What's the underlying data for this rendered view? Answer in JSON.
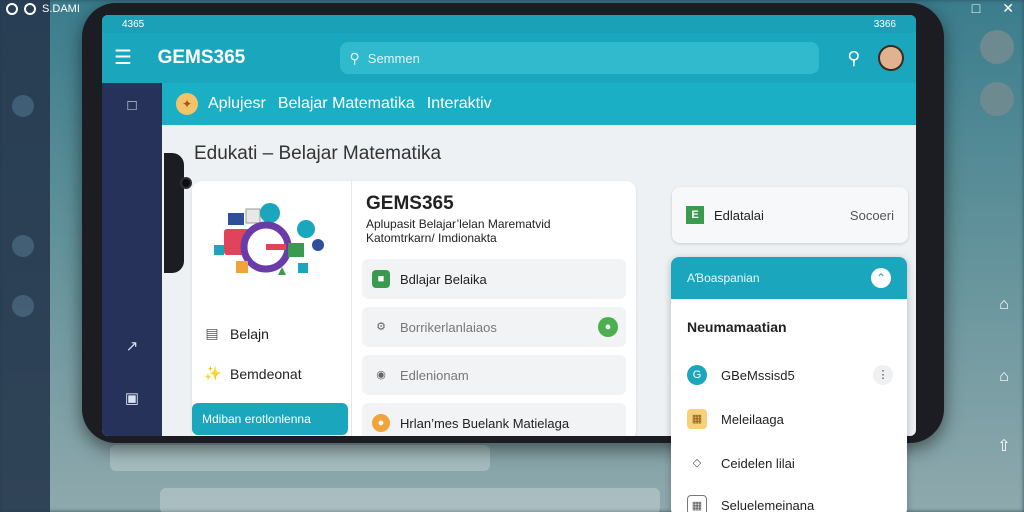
{
  "outer": {
    "status_text": "S.DAMI"
  },
  "phone_status": {
    "time": "4365",
    "battery": "3366"
  },
  "appbar": {
    "title": "GEMS365",
    "search_placeholder": "Semmen"
  },
  "subbar": {
    "items": [
      "Aplujesr",
      "Belajar Matematika",
      "Interaktiv"
    ]
  },
  "page": {
    "heading": "Edukati – Belajar Matematika"
  },
  "card": {
    "title": "GEMS365",
    "subtitle": "Aplupasit Belajar’lelan Marematvid Katomtrkarn/ Imdionakta",
    "left_items": [
      "Belajn",
      "Bemdeonat"
    ],
    "left_button": "Mdiban erotlonlenna",
    "rows": [
      "Bdlajar Belaika",
      "Borrikerlanlaiaos",
      "Edlenionam",
      "Hrlan’mes Buelank Matielaga"
    ]
  },
  "small_card": {
    "label": "Edlatalai",
    "right": "Socoeri"
  },
  "dropdown": {
    "header": "AƁoaspanian",
    "title": "Neumamaatian",
    "items": [
      "GBeMssisd5",
      "Meleilaaga",
      "Ceidelen lilai",
      "Seluelemeinana"
    ]
  },
  "colors": {
    "accent": "#1aa6bd",
    "rail": "#27325a"
  }
}
